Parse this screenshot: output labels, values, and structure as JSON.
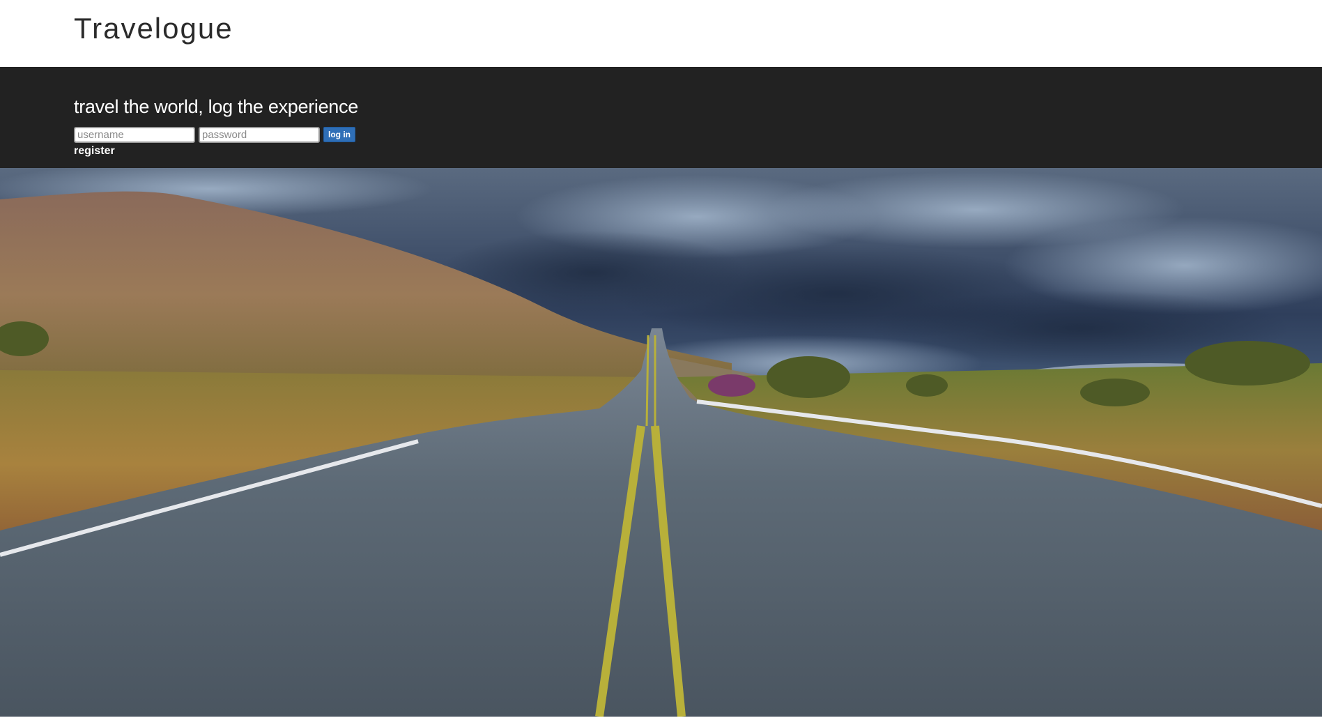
{
  "header": {
    "brand": "Travelogue"
  },
  "hero": {
    "tagline": "travel the world, log the experience",
    "image_description_icon": "landscape-road-photo"
  },
  "login": {
    "username_placeholder": "username",
    "password_placeholder": "password",
    "submit_label": "log in",
    "register_label": "register",
    "button_color": "#2f6fb7"
  },
  "colors": {
    "bar_background": "#222222",
    "page_background": "#ffffff"
  }
}
